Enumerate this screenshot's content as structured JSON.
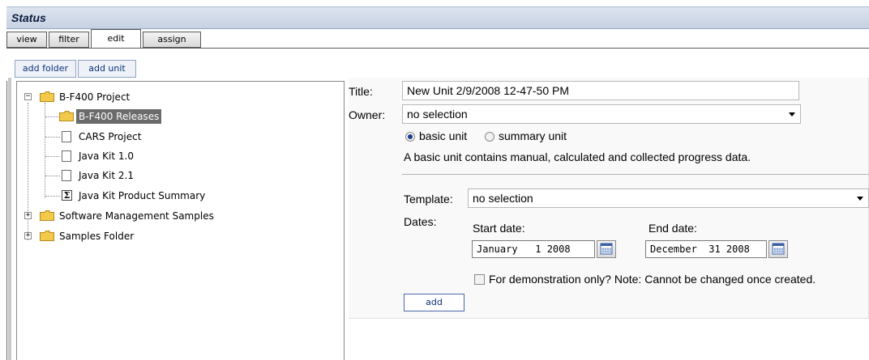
{
  "header": {
    "title": "Status"
  },
  "tabs": [
    {
      "label": "view"
    },
    {
      "label": "filter"
    },
    {
      "label": "edit"
    },
    {
      "label": "assign"
    }
  ],
  "subtoolbar": {
    "add_folder": "add folder",
    "add_unit": "add unit"
  },
  "tree": {
    "items": [
      {
        "label": "B-F400 Project",
        "icon": "folder-icon"
      },
      {
        "label": "B-F400 Releases",
        "icon": "folder-icon",
        "selected": true
      },
      {
        "label": "CARS Project",
        "icon": "file-icon"
      },
      {
        "label": "Java Kit 1.0",
        "icon": "file-icon"
      },
      {
        "label": "Java Kit 2.1",
        "icon": "file-icon"
      },
      {
        "label": "Java Kit Product Summary",
        "icon": "sigma-icon",
        "glyph": "Σ"
      },
      {
        "label": "Software Management Samples",
        "icon": "folder-icon"
      },
      {
        "label": "Samples Folder",
        "icon": "folder-icon"
      }
    ]
  },
  "form": {
    "title_label": "Title:",
    "title_value": "New Unit 2/9/2008 12-47-50 PM",
    "owner_label": "Owner:",
    "owner_value": "no selection",
    "basic_unit": "basic unit",
    "summary_unit": "summary unit",
    "unit_type_selected": "basic unit",
    "description": "A basic unit contains manual, calculated and collected progress data.",
    "template_label": "Template:",
    "template_value": "no selection",
    "dates_label": "Dates:",
    "start_label": "Start date:",
    "start_value": "January   1 2008",
    "end_label": "End date:",
    "end_value": "December  31 2008",
    "demo_label": "For demonstration only? Note: Cannot be changed once created.",
    "demo_checked": false,
    "add_label": "add"
  },
  "colors": {
    "header_bg": "#c6d1e2",
    "selected_bg": "#6b6b6b",
    "folder": "#f3c94a",
    "link_text": "#0b2f7a"
  }
}
